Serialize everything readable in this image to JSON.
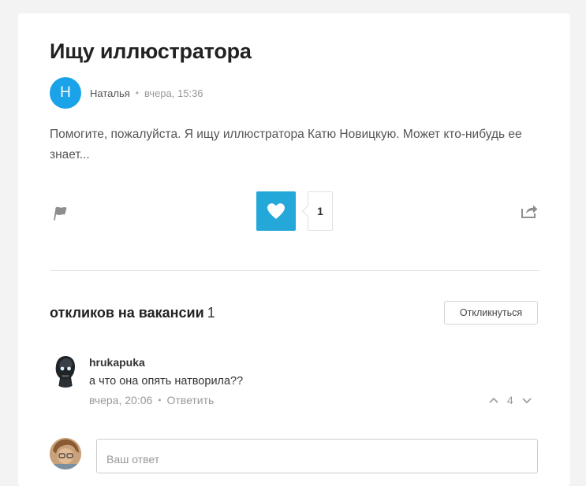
{
  "post": {
    "title": "Ищу иллюстратора",
    "author_initial": "Н",
    "author_name": "Наталья",
    "separator": "•",
    "time": "вчера, 15:36",
    "body": "Помогите, пожалуйста. Я ищу иллюстратора Катю Новицкую. Может кто-нибудь ее знает...",
    "likes": "1"
  },
  "responses": {
    "title": "откликов на вакансии",
    "count": "1",
    "respond_label": "Откликнуться"
  },
  "comment": {
    "user": "hrukapuka",
    "text": "а что она опять натворила??",
    "time": "вчера, 20:06",
    "separator": "•",
    "reply_label": "Ответить",
    "votes": "4"
  },
  "reply_box": {
    "placeholder": "Ваш ответ"
  },
  "colors": {
    "accent": "#23a8d9",
    "avatar": "#1aa3e8"
  },
  "icons": [
    "flag-icon",
    "heart-icon",
    "share-icon",
    "chevron-up-icon",
    "chevron-down-icon"
  ]
}
